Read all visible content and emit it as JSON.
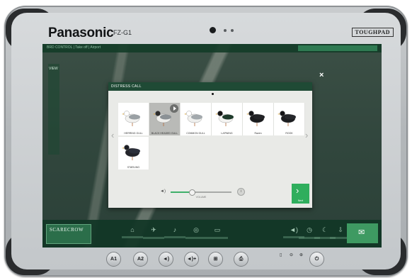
{
  "device": {
    "brand": "Panasonic",
    "model": "FZ-G1",
    "badge": "TOUGHPAD"
  },
  "app": {
    "topbar_text": "BRD CONTROL | Take off | Airport",
    "left_rail_label": "VIEW",
    "brand_label": "SCARECROW",
    "close_glyph": "×",
    "bottom_items": [
      {
        "name": "home-icon",
        "glyph": "⌂"
      },
      {
        "name": "bird-icon",
        "glyph": "✈"
      },
      {
        "name": "speaker-icon",
        "glyph": "♪"
      },
      {
        "name": "target-icon",
        "glyph": "◎"
      },
      {
        "name": "calendar-icon",
        "glyph": "▭"
      },
      {
        "name": "volume-icon",
        "glyph": "◄)"
      },
      {
        "name": "clock-icon",
        "glyph": "◷"
      },
      {
        "name": "moon-icon",
        "glyph": "☾"
      },
      {
        "name": "download-icon",
        "glyph": "⇩"
      }
    ],
    "action_glyph": "✉"
  },
  "dialog": {
    "title": "DISTRESS CALL",
    "prev_glyph": "‹",
    "next_glyph": "›",
    "birds": [
      {
        "label": "HERRING GULL",
        "body": "#f2f2f0",
        "wing": "#9aa0a4",
        "head": "#ffffff",
        "selected": false
      },
      {
        "label": "BLACK HEADED GULL",
        "body": "#efefec",
        "wing": "#8b9195",
        "head": "#2c2c2c",
        "selected": true
      },
      {
        "label": "COMMON GULL",
        "body": "#f0f0ee",
        "wing": "#a3a9ad",
        "head": "#ffffff",
        "selected": false
      },
      {
        "label": "LAPWING",
        "body": "#f4f4f2",
        "wing": "#1f3b2c",
        "head": "#151515",
        "selected": false
      },
      {
        "label": "Raven",
        "body": "#1a1b1d",
        "wing": "#222326",
        "head": "#161719",
        "selected": false
      },
      {
        "label": "ROOK",
        "body": "#1c1d20",
        "wing": "#26272b",
        "head": "#141416",
        "selected": false
      },
      {
        "label": "STARLING",
        "body": "#23242a",
        "wing": "#2c2f3a",
        "head": "#1d1e24",
        "selected": false
      }
    ],
    "volume_glyph": "◄)",
    "slider_caption": "VOLUME",
    "slider_level": 0.35,
    "info_glyph": "i",
    "next_label": "Next",
    "next_chevron": "›"
  },
  "hardware_buttons": [
    "A1",
    "A2",
    "◄)",
    "◄)+",
    "⊞",
    "⎙"
  ],
  "hardware_indicators": [
    "▯",
    "⊖",
    "⊕"
  ],
  "power_glyph": "⏻"
}
